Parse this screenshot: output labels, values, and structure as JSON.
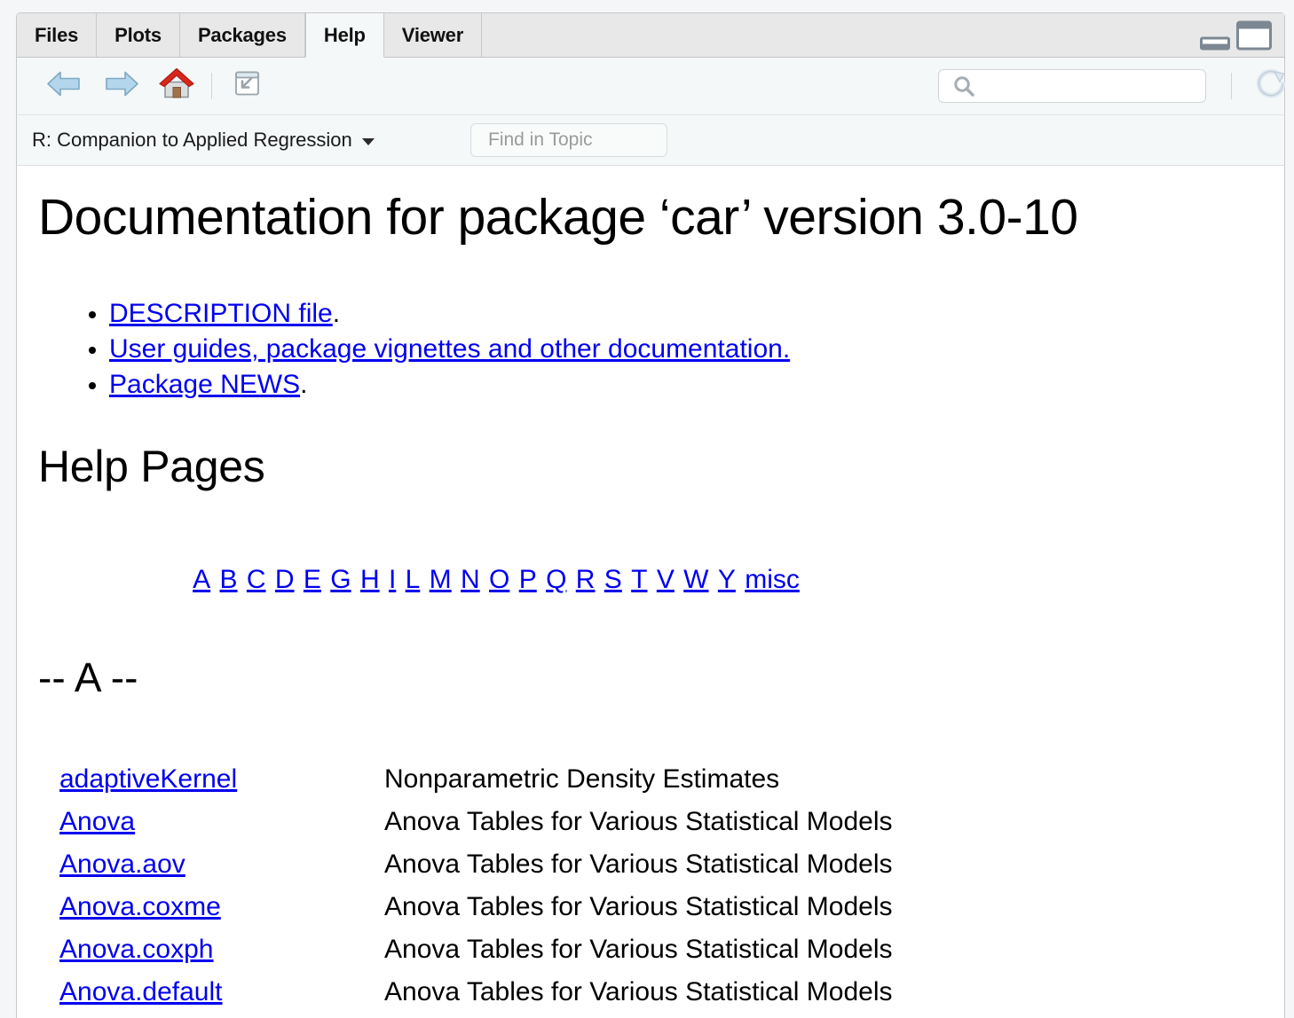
{
  "window": {
    "tabs": [
      {
        "label": "Files",
        "active": false
      },
      {
        "label": "Plots",
        "active": false
      },
      {
        "label": "Packages",
        "active": false
      },
      {
        "label": "Help",
        "active": true
      },
      {
        "label": "Viewer",
        "active": false
      }
    ],
    "controls": {
      "minimize": "minimize-icon",
      "maximize": "maximize-icon"
    }
  },
  "toolbar": {
    "back": "back-arrow-icon",
    "forward": "forward-arrow-icon",
    "home": "home-icon",
    "popout": "show-in-new-window-icon",
    "refresh": "refresh-icon",
    "search": {
      "icon": "search-icon",
      "value": "",
      "placeholder": ""
    }
  },
  "topicbar": {
    "topic": "R: Companion to Applied Regression",
    "dropdown_icon": "chevron-down-icon",
    "find": {
      "value": "",
      "placeholder": "Find in Topic"
    }
  },
  "page": {
    "title": "Documentation for package ‘car’ version 3.0-10",
    "links": [
      {
        "text": "DESCRIPTION file",
        "suffix": "."
      },
      {
        "text": "User guides, package vignettes and other documentation.",
        "suffix": ""
      },
      {
        "text": "Package NEWS",
        "suffix": "."
      }
    ],
    "help_pages_heading": "Help Pages",
    "alpha_index": [
      "A",
      "B",
      "C",
      "D",
      "E",
      "G",
      "H",
      "I",
      "L",
      "M",
      "N",
      "O",
      "P",
      "Q",
      "R",
      "S",
      "T",
      "V",
      "W",
      "Y",
      "misc"
    ],
    "section_heading": "-- A --",
    "entries": [
      {
        "name": "adaptiveKernel",
        "description": "Nonparametric Density Estimates"
      },
      {
        "name": "Anova",
        "description": "Anova Tables for Various Statistical Models"
      },
      {
        "name": "Anova.aov",
        "description": "Anova Tables for Various Statistical Models"
      },
      {
        "name": "Anova.coxme",
        "description": "Anova Tables for Various Statistical Models"
      },
      {
        "name": "Anova.coxph",
        "description": "Anova Tables for Various Statistical Models"
      },
      {
        "name": "Anova.default",
        "description": "Anova Tables for Various Statistical Models"
      }
    ]
  },
  "colors": {
    "link": "#0000ee",
    "panel_bg": "#f4f8f9",
    "tab_bg": "#e8e8e8",
    "home_roof": "#d72b1f",
    "arrow_blue": "#a8cfe8"
  }
}
